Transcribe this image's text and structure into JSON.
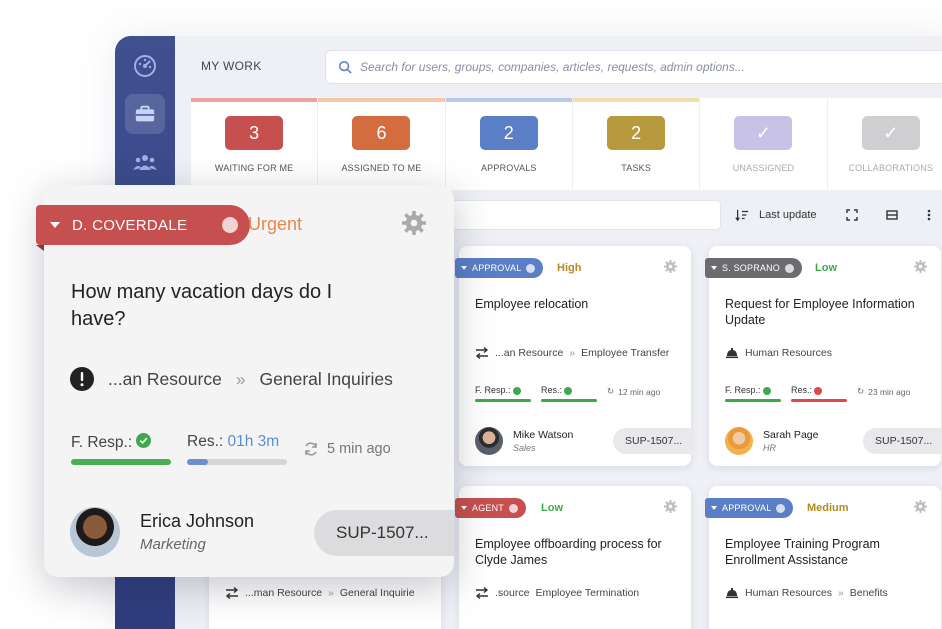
{
  "header": {
    "section_label": "MY WORK",
    "search_placeholder": "Search for users, groups, companies, articles, requests, admin options..."
  },
  "stats": [
    {
      "count": "3",
      "label": "WAITING FOR ME",
      "color": "#c5504f",
      "bar": "#e9a3a3"
    },
    {
      "count": "6",
      "label": "ASSIGNED TO ME",
      "color": "#d36d3f",
      "bar": "#f3c7a9"
    },
    {
      "count": "2",
      "label": "APPROVALS",
      "color": "#5a7fc6",
      "bar": "#b7c8ec"
    },
    {
      "count": "2",
      "label": "TASKS",
      "color": "#b89a3e",
      "bar": "#f0e0a8"
    },
    {
      "count": "✓",
      "label": "UNASSIGNED",
      "color": "#c8c2e6",
      "bar": "#ffffff"
    },
    {
      "count": "✓",
      "label": "COLLABORATIONS",
      "color": "#cfcfd1",
      "bar": "#ffffff"
    }
  ],
  "toolbar": {
    "sort_label": "Last update"
  },
  "featured_card": {
    "agent": "D. COVERDALE",
    "priority": "Urgent",
    "title": "How many vacation days do I have?",
    "category": "...an Resource",
    "subcategory": "General Inquiries",
    "first_response_label": "F. Resp.:",
    "resolution_label": "Res.:",
    "resolution_time": "01h 3m",
    "updated": "5 min ago",
    "requester_name": "Erica Johnson",
    "requester_dept": "Marketing",
    "ticket": "SUP-1507..."
  },
  "cards": [
    {
      "tag": "APPROVAL",
      "tag_color": "#5a7fc6",
      "priority": "High",
      "priority_color": "#b58a1e",
      "title": "Employee relocation",
      "category": "...an Resource",
      "subcategory": "Employee Transfer",
      "first_response_label": "F. Resp.:",
      "resolution_label": "Res.:",
      "updated": "12 min ago",
      "requester_name": "Mike Watson",
      "requester_dept": "Sales",
      "ticket": "SUP-1507..."
    },
    {
      "tag": "S. SOPRANO",
      "tag_color": "#6c6c70",
      "priority": "Low",
      "priority_color": "#3daa4a",
      "title": "Request for Employee Information Update",
      "category": "Human Resources",
      "subcategory": "",
      "first_response_label": "F. Resp.:",
      "resolution_label": "Res.:",
      "updated": "23 min ago",
      "requester_name": "Sarah Page",
      "requester_dept": "HR",
      "ticket": "SUP-1507..."
    },
    {
      "tag": "AGENT",
      "tag_color": "#c6504f",
      "priority": "Low",
      "priority_color": "#3daa4a",
      "title": "Employee offboarding process for Clyde James",
      "category": ".source",
      "subcategory": "Employee Termination"
    },
    {
      "tag": "APPROVAL",
      "tag_color": "#5a7fc6",
      "priority": "Medium",
      "priority_color": "#b58a1e",
      "title": "Employee Training Program Enrollment Assistance",
      "category": "Human Resources",
      "subcategory": "Benefits"
    },
    {
      "category": "...man Resource",
      "subcategory": "General Inquirie"
    }
  ]
}
